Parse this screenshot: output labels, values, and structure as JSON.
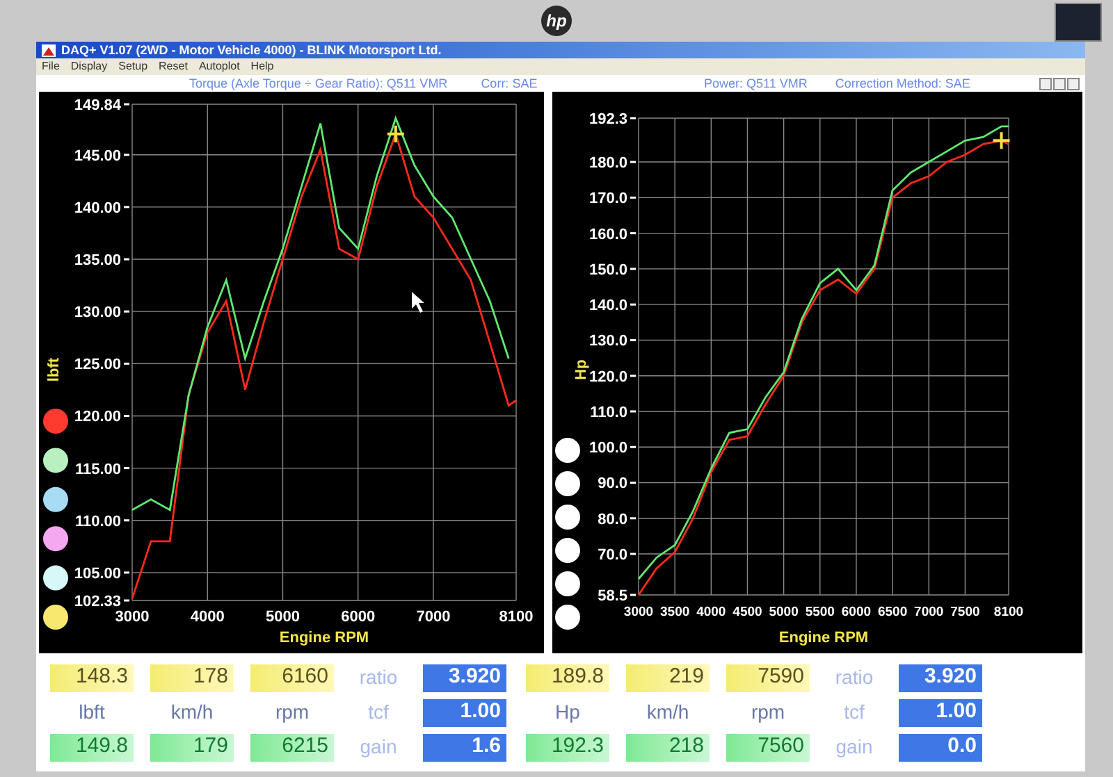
{
  "monitor": {
    "logo": "hp"
  },
  "window": {
    "title": "DAQ+ V1.07 (2WD - Motor Vehicle 4000) - BLINK Motorsport Ltd.",
    "menu": [
      "File",
      "Display",
      "Setup",
      "Reset",
      "Autoplot",
      "Help"
    ]
  },
  "charts": [
    {
      "captions": [
        "Torque (Axle Torque ÷ Gear Ratio): Q511 VMR",
        "Corr: SAE"
      ],
      "legend": [
        {
          "color": "#ff3b2f"
        },
        {
          "color": "#b8f0c0"
        },
        {
          "color": "#a8dcf4"
        },
        {
          "color": "#f4a8f0"
        },
        {
          "color": "#d8f8f8"
        },
        {
          "color": "#f8e870"
        }
      ],
      "chart_data": {
        "type": "line",
        "grid": true,
        "xlabel": "Engine RPM",
        "ylabel": "lbft",
        "x": [
          3000,
          3250,
          3500,
          3750,
          4000,
          4250,
          4500,
          4750,
          5000,
          5250,
          5500,
          5750,
          6000,
          6250,
          6500,
          6750,
          7000,
          7250,
          7500,
          7750,
          8000,
          8100
        ],
        "series": [
          {
            "color": "#ff2a1a",
            "values": [
              102.5,
              108,
              108,
              122,
              128,
              131,
              122.5,
              129,
              135,
              141,
              145.5,
              136,
              135,
              142,
              147,
              141,
              139,
              136,
              133,
              127,
              121,
              121.5
            ]
          },
          {
            "color": "#60e870",
            "values": [
              111,
              112,
              111,
              122,
              128.5,
              133,
              125.5,
              131,
              136,
              142,
              148,
              138,
              136,
              143,
              148.5,
              144,
              141,
              139,
              135,
              131,
              125.5,
              null
            ]
          }
        ],
        "xlim": [
          3000,
          8100
        ],
        "ylim": [
          102.33,
          149.84
        ],
        "xticks": [
          3000,
          4000,
          5000,
          6000,
          7000,
          8100
        ],
        "yticks": [
          {
            "value": 102.33,
            "label": "102.33"
          },
          {
            "value": 105,
            "label": "105.00"
          },
          {
            "value": 110,
            "label": "110.00"
          },
          {
            "value": 115,
            "label": "115.00"
          },
          {
            "value": 120,
            "label": "120.00"
          },
          {
            "value": 125,
            "label": "125.00"
          },
          {
            "value": 130,
            "label": "130.00"
          },
          {
            "value": 135,
            "label": "135.00"
          },
          {
            "value": 140,
            "label": "140.00"
          },
          {
            "value": 145,
            "label": "145.00"
          },
          {
            "value": 149.84,
            "label": "149.84"
          }
        ]
      }
    },
    {
      "captions": [
        "Power: Q511 VMR",
        "Correction Method: SAE"
      ],
      "legend": [
        {
          "color": "#ffffff"
        },
        {
          "color": "#ffffff"
        },
        {
          "color": "#ffffff"
        },
        {
          "color": "#ffffff"
        },
        {
          "color": "#ffffff"
        },
        {
          "color": "#ffffff"
        }
      ],
      "chart_data": {
        "type": "line",
        "grid": true,
        "xlabel": "Engine RPM",
        "ylabel": "Hp",
        "x": [
          3000,
          3250,
          3500,
          3750,
          4000,
          4250,
          4500,
          4750,
          5000,
          5250,
          5500,
          5750,
          6000,
          6250,
          6500,
          6750,
          7000,
          7250,
          7500,
          7750,
          8000,
          8100
        ],
        "series": [
          {
            "color": "#ff2a1a",
            "values": [
              58.5,
              66,
              70.5,
              80,
              93,
              102,
              103,
              112,
              120,
              135,
              144,
              147,
              143,
              150,
              170,
              174,
              176,
              180,
              182,
              185,
              186,
              185
            ]
          },
          {
            "color": "#60e870",
            "values": [
              63,
              69,
              72.5,
              82,
              94,
              104,
              105,
              114,
              121,
              136,
              146,
              150,
              144,
              151,
              172,
              177,
              180,
              183,
              186,
              187,
              190,
              190
            ]
          }
        ],
        "xlim": [
          3000,
          8100
        ],
        "ylim": [
          58.5,
          192.3
        ],
        "xticks": [
          3000,
          3500,
          4000,
          4500,
          5000,
          5500,
          6000,
          6500,
          7000,
          7500,
          8100
        ],
        "yticks": [
          {
            "value": 58.5,
            "label": "58.5"
          },
          {
            "value": 70,
            "label": "70.0"
          },
          {
            "value": 80,
            "label": "80.0"
          },
          {
            "value": 90,
            "label": "90.0"
          },
          {
            "value": 100,
            "label": "100.0"
          },
          {
            "value": 110,
            "label": "110.0"
          },
          {
            "value": 120,
            "label": "120.0"
          },
          {
            "value": 130,
            "label": "130.0"
          },
          {
            "value": 140,
            "label": "140.0"
          },
          {
            "value": 150,
            "label": "150.0"
          },
          {
            "value": 160,
            "label": "160.0"
          },
          {
            "value": 170,
            "label": "170.0"
          },
          {
            "value": 180,
            "label": "180.0"
          },
          {
            "value": 192.3,
            "label": "192.3"
          }
        ]
      }
    }
  ],
  "readouts": [
    {
      "current": [
        "148.3",
        "178",
        "6160"
      ],
      "units": [
        "lbft",
        "km/h",
        "rpm"
      ],
      "peak": [
        "149.8",
        "179",
        "6215"
      ],
      "factors": [
        {
          "label": "ratio",
          "value": "3.920"
        },
        {
          "label": "tcf",
          "value": "1.00"
        },
        {
          "label": "gain",
          "value": "1.6"
        }
      ]
    },
    {
      "current": [
        "189.8",
        "219",
        "7590"
      ],
      "units": [
        "Hp",
        "km/h",
        "rpm"
      ],
      "peak": [
        "192.3",
        "218",
        "7560"
      ],
      "factors": [
        {
          "label": "ratio",
          "value": "3.920"
        },
        {
          "label": "tcf",
          "value": "1.00"
        },
        {
          "label": "gain",
          "value": "0.0"
        }
      ]
    }
  ]
}
